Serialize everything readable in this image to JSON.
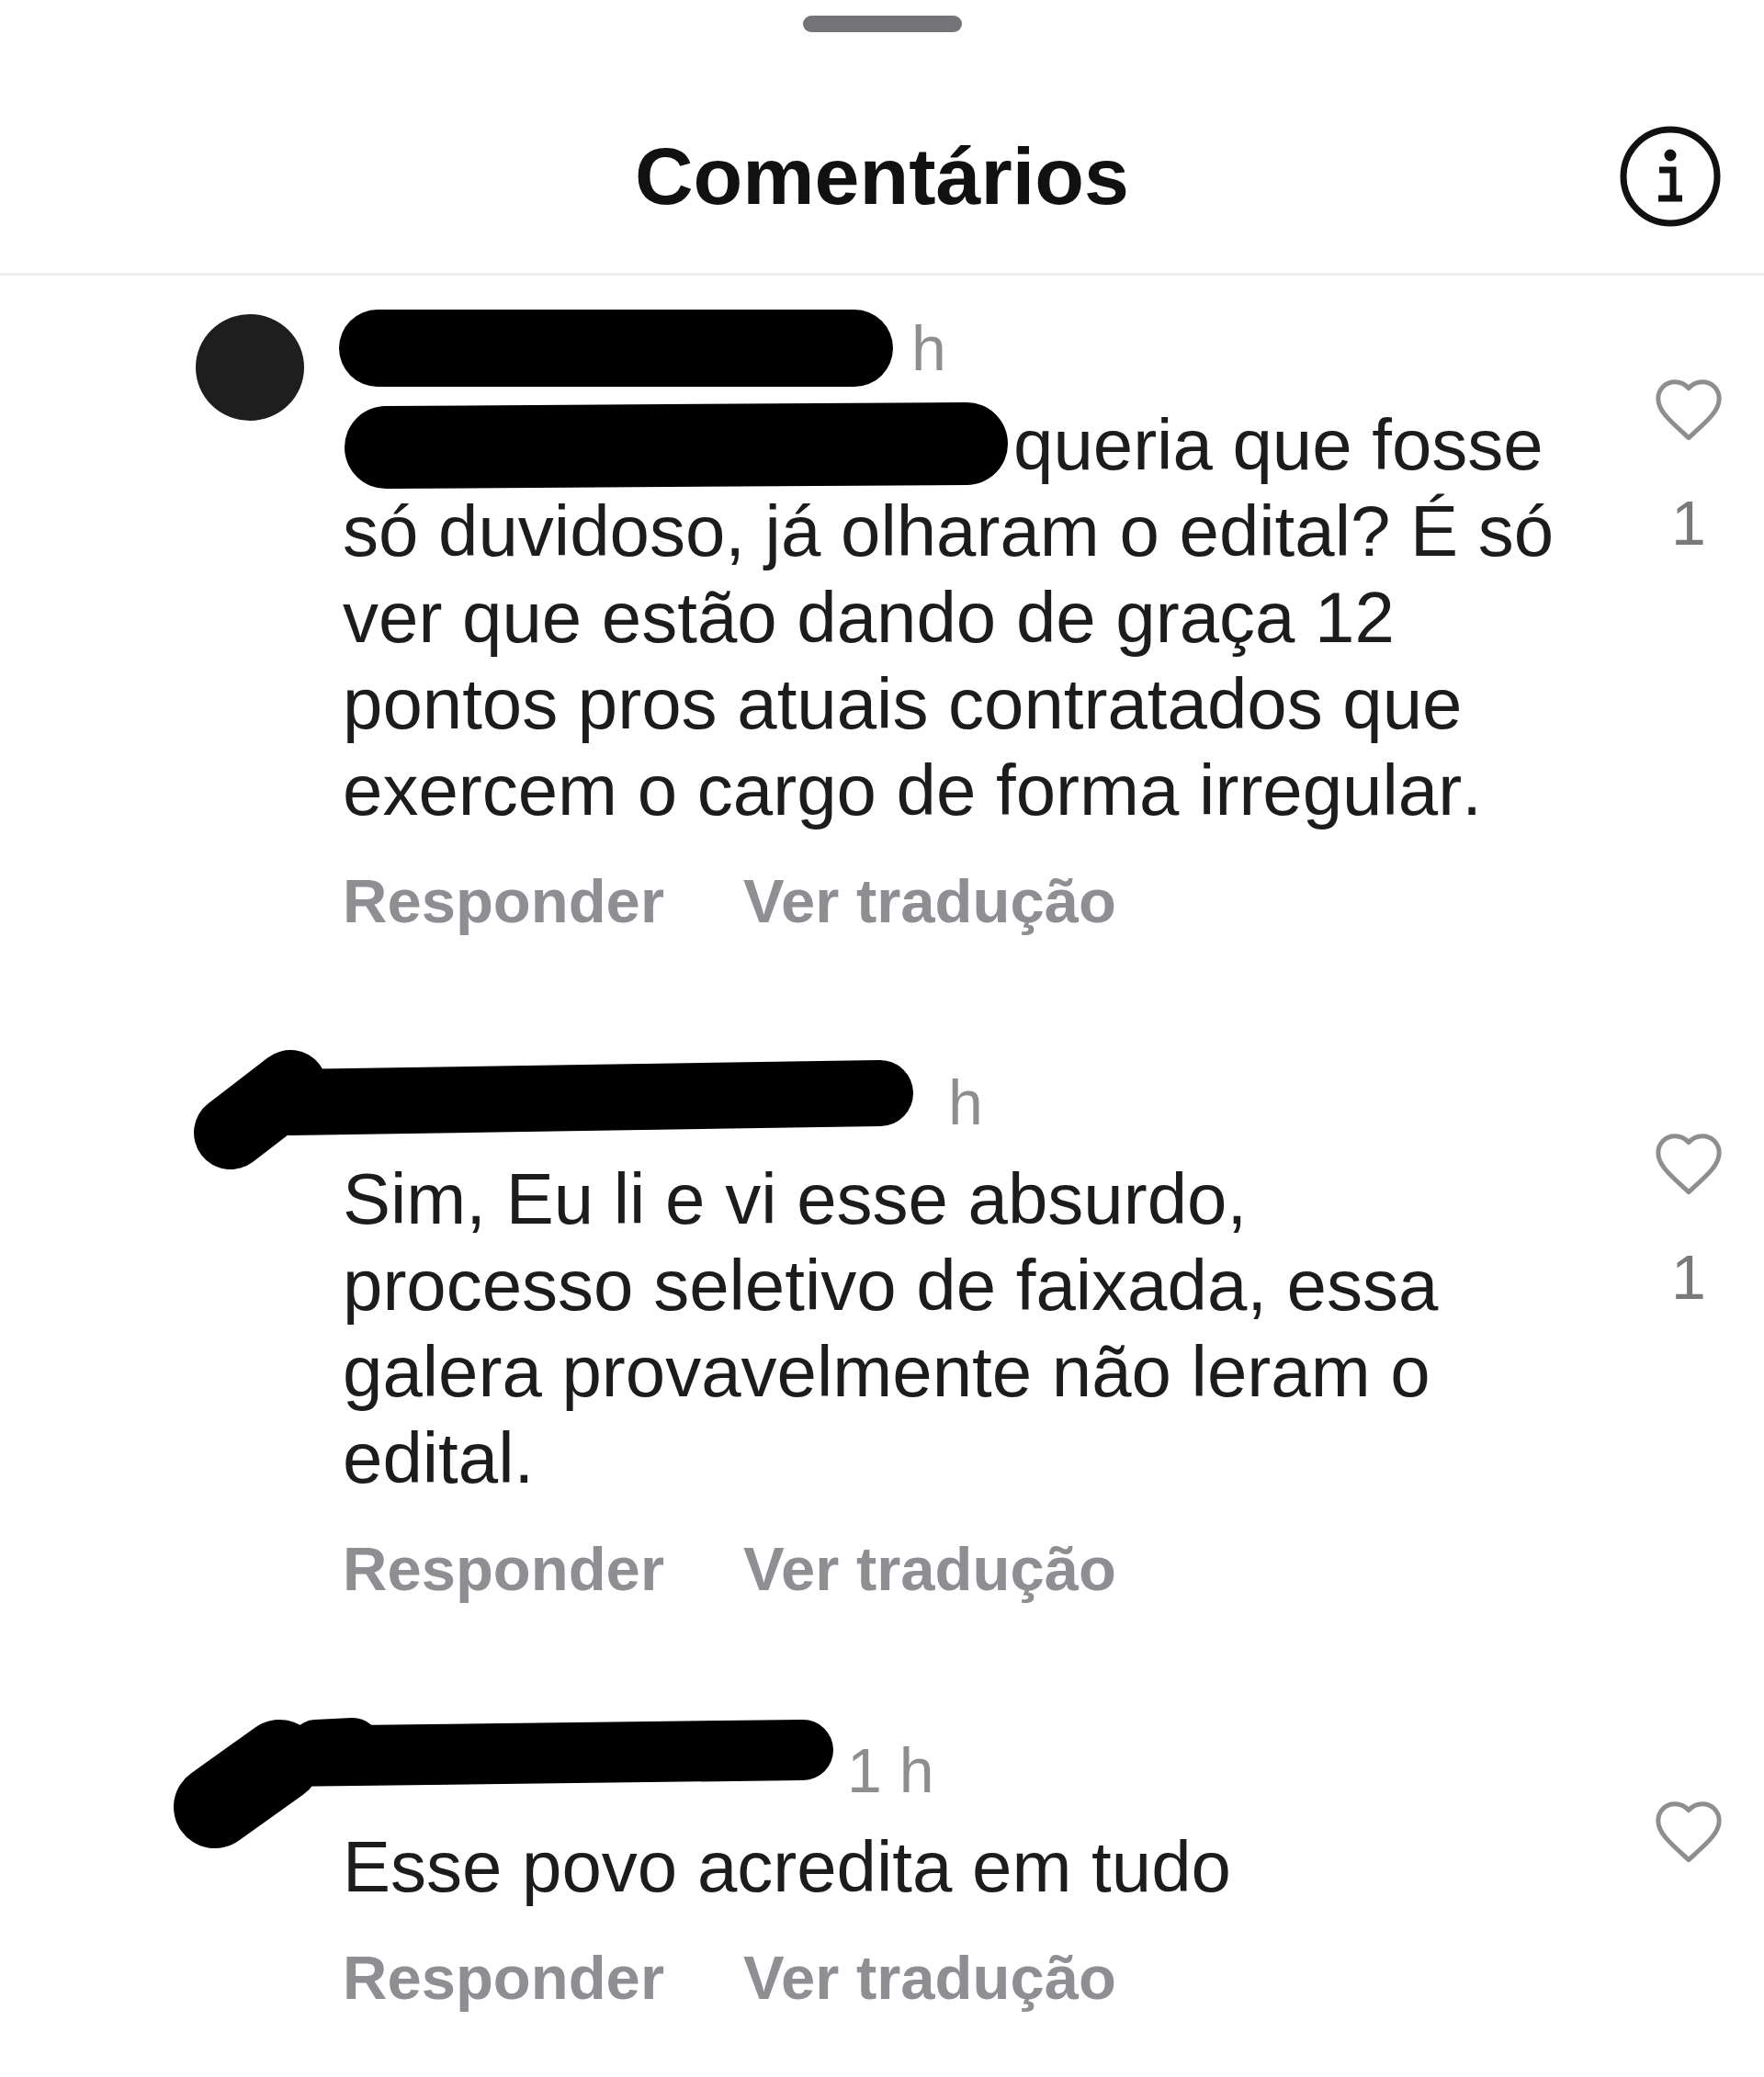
{
  "sheet": {
    "title": "Comentários"
  },
  "comments": [
    {
      "avatar_shown": true,
      "time": "h",
      "mention_hidden": true,
      "text": "queria que fosse só duvidoso, já olharam o edital? É só ver que estão dando de graça 12 pontos pros atuais contratados que exercem o cargo de forma irregular.",
      "liked": false,
      "likes": "1",
      "actions": [
        "Responder",
        "Ver tradução"
      ]
    },
    {
      "avatar_shown": false,
      "time": "h",
      "mention_hidden": false,
      "text": "Sim, Eu li e vi esse absurdo, processo seletivo de faixada, essa galera provavelmente não leram o edital.",
      "liked": false,
      "likes": "1",
      "actions": [
        "Responder",
        "Ver tradução"
      ]
    },
    {
      "avatar_shown": false,
      "time": "1 h",
      "mention_hidden": false,
      "text": "Esse povo acredita em tudo",
      "liked": false,
      "actions": [
        "Responder",
        "Ver tradução"
      ]
    }
  ]
}
